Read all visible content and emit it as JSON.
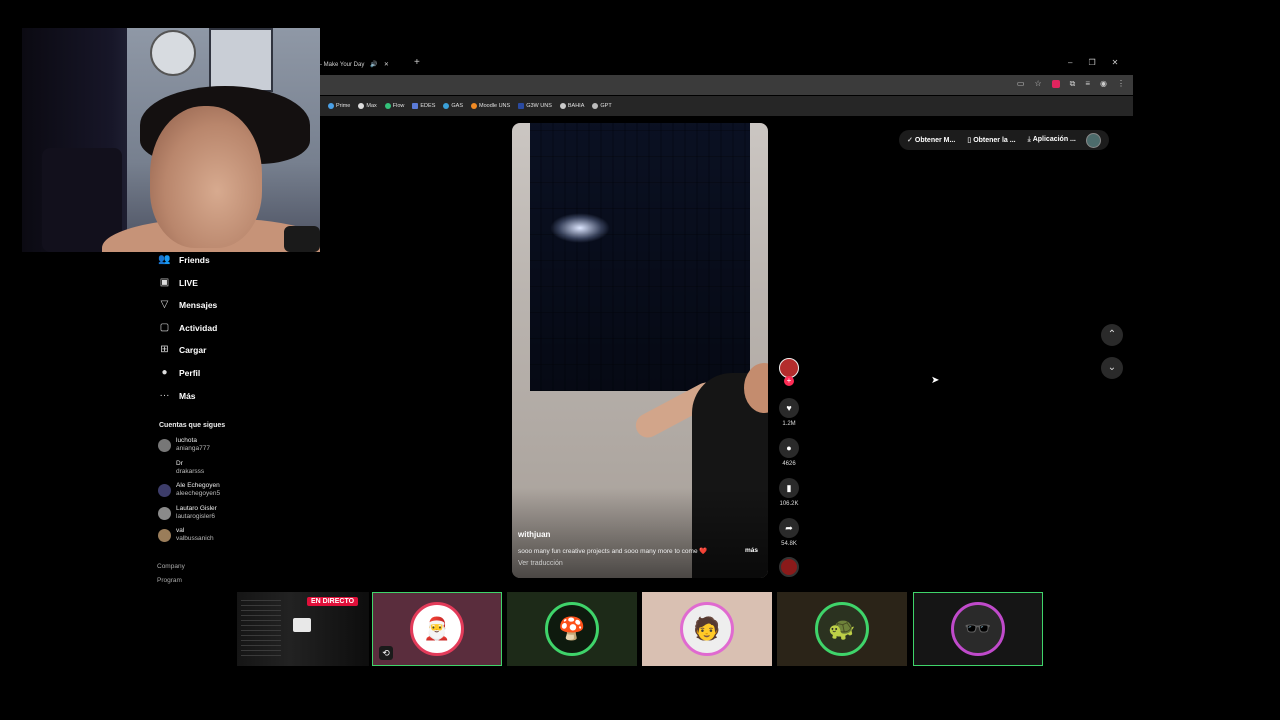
{
  "browser": {
    "tab_title": "- Make Your Day",
    "tab_icons": [
      "speaker-icon",
      "close-icon"
    ],
    "new_tab": "+",
    "window_controls": [
      "–",
      "❐",
      "✕"
    ],
    "bookmarks": [
      "Prime",
      "Max",
      "Flow",
      "EDES",
      "GAS",
      "Moodle UNS",
      "G3W UNS",
      "BAHIA",
      "GPT"
    ]
  },
  "sidebar": {
    "nav": [
      {
        "icon": "friends-icon",
        "glyph": "👥",
        "label": "Friends"
      },
      {
        "icon": "live-icon",
        "glyph": "▣",
        "label": "LIVE"
      },
      {
        "icon": "messages-icon",
        "glyph": "▽",
        "label": "Mensajes"
      },
      {
        "icon": "activity-icon",
        "glyph": "▢",
        "label": "Actividad"
      },
      {
        "icon": "upload-icon",
        "glyph": "⊞",
        "label": "Cargar"
      },
      {
        "icon": "profile-icon",
        "glyph": "●",
        "label": "Perfil"
      },
      {
        "icon": "more-icon",
        "glyph": "···",
        "label": "Más"
      }
    ],
    "following_title": "Cuentas que sigues",
    "accounts": [
      {
        "name": "luchota",
        "handle": "anianga777"
      },
      {
        "name": "Dr",
        "handle": "drakarsss"
      },
      {
        "name": "Ale Echegoyen",
        "handle": "aleechegoyen5"
      },
      {
        "name": "Lautaro Gisler",
        "handle": "lautarogisler6"
      },
      {
        "name": "val",
        "handle": "valbussanich"
      }
    ],
    "footer": {
      "company": "Company",
      "program": "Program"
    }
  },
  "video": {
    "username": "withjuan",
    "caption": "sooo many fun creative projects and sooo many more to come ❤️",
    "more": "más",
    "translate": "Ver traducción",
    "likes": "1.2M",
    "comments": "4626",
    "saves": "106.2K",
    "shares": "54.8K"
  },
  "top_actions": {
    "items": [
      "Obtener M...",
      "Obtener la ...",
      "Aplicación ..."
    ],
    "item_icons": [
      "✓",
      "▯",
      "⤓"
    ]
  },
  "stream": {
    "live_badge": "EN DIRECTO",
    "tile_emojis": [
      "🎅",
      "🍄",
      "🧑",
      "🐢",
      "🕶️"
    ]
  }
}
